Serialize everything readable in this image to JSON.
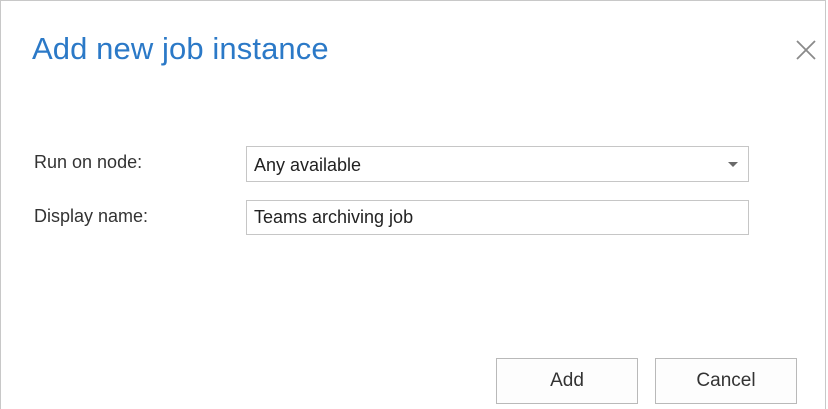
{
  "dialog": {
    "title": "Add new job instance",
    "close_icon": "close-icon"
  },
  "form": {
    "run_on_node": {
      "label": "Run on node:",
      "value": "Any available",
      "icon": "chevron-down-icon"
    },
    "display_name": {
      "label": "Display name:",
      "value": "Teams archiving job"
    }
  },
  "actions": {
    "add_label": "Add",
    "cancel_label": "Cancel"
  },
  "colors": {
    "title": "#2b79c7",
    "border": "#c6c6c6"
  }
}
